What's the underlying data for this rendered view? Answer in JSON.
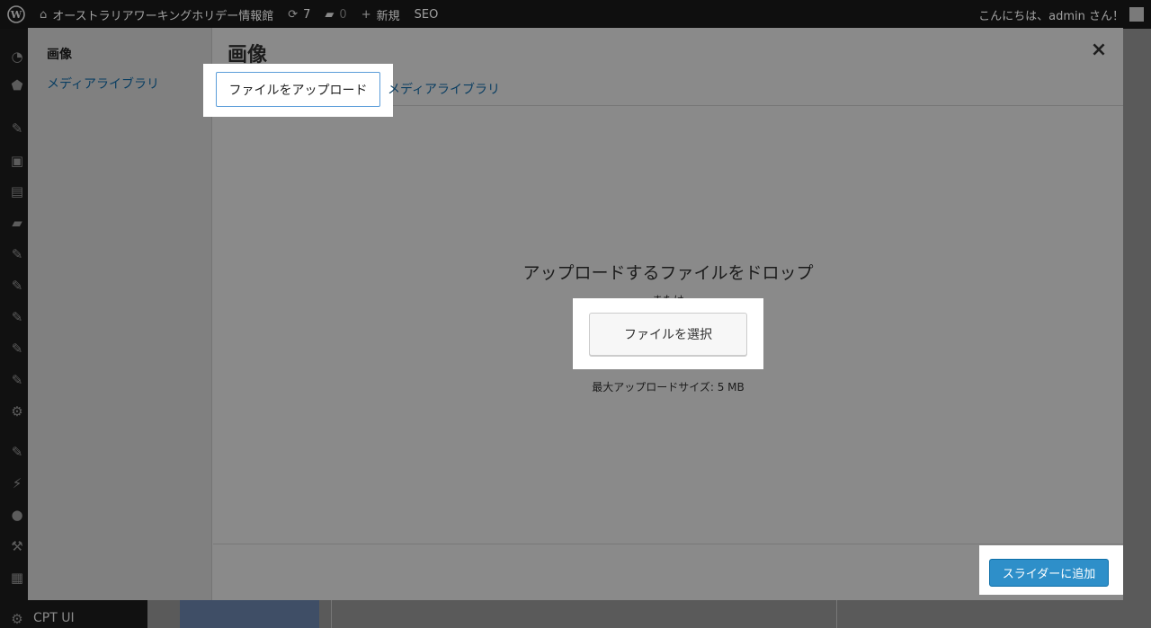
{
  "adminbar": {
    "site_name": "オーストラリアワーキングホリデー情報館",
    "updates_count": "7",
    "comments_count": "0",
    "new_label": "新規",
    "seo_label": "SEO",
    "greeting": "こんにちは、admin さん！"
  },
  "adminmenu": {
    "last_item_label": "CPT UI"
  },
  "modal": {
    "menu": {
      "heading": "画像",
      "library_link": "メディアライブラリ"
    },
    "title": "画像",
    "close_symbol": "×",
    "tabs": {
      "upload": "ファイルをアップロード",
      "library": "メディアライブラリ"
    },
    "uploader": {
      "drop_instructions": "アップロードするファイルをドロップ",
      "or_text": "または",
      "select_button": "ファイルを選択",
      "max_size": "最大アップロードサイズ: 5 MB"
    },
    "toolbar": {
      "add_button": "スライダーに追加"
    }
  },
  "colors": {
    "primary_button": "#2e8fc9",
    "link": "#0a3e62",
    "adminbar_bg": "#0f0f0f"
  }
}
